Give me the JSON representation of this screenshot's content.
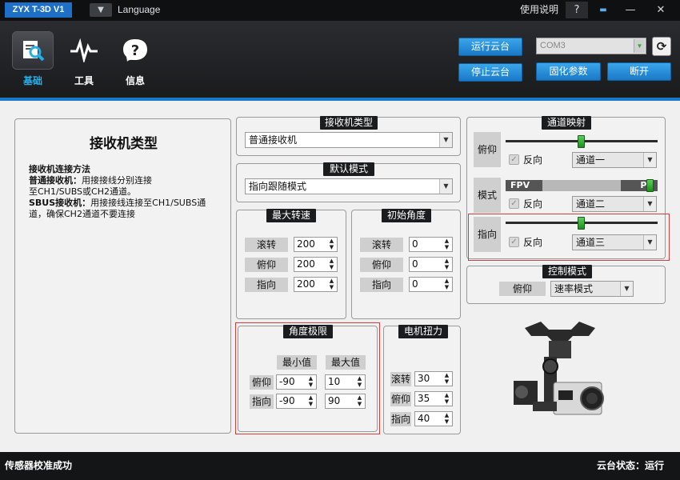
{
  "titlebar": {
    "app_title": "ZYX T-3D V1",
    "language_label": "Language",
    "help_label": "使用说明",
    "help_btn": "?",
    "chat_btn": "▬",
    "min_btn": "—",
    "close_btn": "✕"
  },
  "nav": {
    "basic": "基础",
    "tools": "工具",
    "info": "信息"
  },
  "header": {
    "run_gimbal": "运行云台",
    "stop_gimbal": "停止云台",
    "com_port": "COM3",
    "solidify_params": "固化参数",
    "disconnect": "断开"
  },
  "receiver_info": {
    "title": "接收机类型",
    "method_heading": "接收机连接方法",
    "normal_bold": "普通接收机：",
    "normal_text1": "用接接线分别连接",
    "normal_text2": "至CH1/SUBS或CH2通道。",
    "sbus_bold": "SBUS接收机：",
    "sbus_text1": "用接接线连接至CH1/SUBS通",
    "sbus_text2": "道，确保CH2通道不要连接"
  },
  "receiver_type": {
    "title": "接收机类型",
    "value": "普通接收机"
  },
  "default_mode": {
    "title": "默认模式",
    "value": "指向跟随模式"
  },
  "max_speed": {
    "title": "最大转速",
    "roll_label": "滚转",
    "roll": "200",
    "pitch_label": "俯仰",
    "pitch": "200",
    "yaw_label": "指向",
    "yaw": "200"
  },
  "init_angle": {
    "title": "初始角度",
    "roll_label": "滚转",
    "roll": "0",
    "pitch_label": "俯仰",
    "pitch": "0",
    "yaw_label": "指向",
    "yaw": "0"
  },
  "angle_limit": {
    "title": "角度极限",
    "min_header": "最小值",
    "max_header": "最大值",
    "pitch_label": "俯仰",
    "pitch_min": "-90",
    "pitch_max": "10",
    "yaw_label": "指向",
    "yaw_min": "-90",
    "yaw_max": "90"
  },
  "motor_torque": {
    "title": "电机扭力",
    "roll_label": "滚转",
    "roll": "30",
    "pitch_label": "俯仰",
    "pitch": "35",
    "yaw_label": "指向",
    "yaw": "40"
  },
  "channel_map": {
    "title": "通道映射",
    "pitch_label": "俯仰",
    "pitch_reverse": "反向",
    "pitch_channel": "通道一",
    "pitch_slider": 0.5,
    "mode_label": "模式",
    "mode_left": "FPV",
    "mode_right": "PF",
    "mode_reverse": "反向",
    "mode_channel": "通道二",
    "mode_slider": 0.95,
    "yaw_label": "指向",
    "yaw_reverse": "反向",
    "yaw_channel": "通道三",
    "yaw_slider": 0.5
  },
  "control_mode": {
    "title": "控制模式",
    "pitch_label": "俯仰",
    "value": "速率模式"
  },
  "status": {
    "left": "传感器校准成功",
    "right": "云台状态：运行"
  },
  "colors": {
    "accent": "#1a78c8",
    "active_nav": "#26aee8",
    "highlight_border": "#d04040",
    "slider_green": "#2fa82f"
  }
}
